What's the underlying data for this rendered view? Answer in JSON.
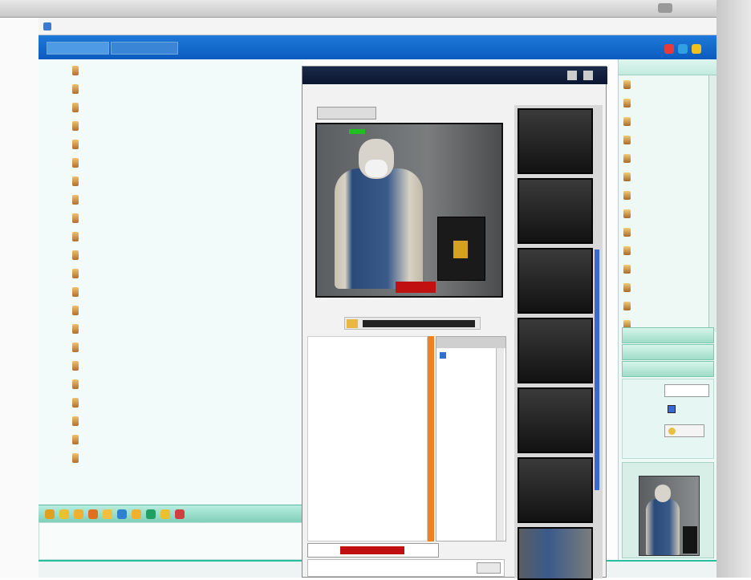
{
  "browser": {
    "title": "",
    "address": "",
    "tabs": [
      {
        "label": ""
      },
      {
        "label": ""
      }
    ]
  },
  "chat": {
    "lines": [
      {
        "ts": "",
        "name": "",
        "text": "",
        "name_color": "#2a9a2a",
        "text_color": "#2a9a2a"
      },
      {
        "ts": "",
        "name": "",
        "text": "",
        "name_color": "#d020c0",
        "text_color": "#d020c0"
      },
      {
        "ts": "",
        "name": "",
        "text": "",
        "name_color": "#8030d0",
        "text_color": "#20a080"
      },
      {
        "ts": "",
        "name": "",
        "text": "",
        "name_color": "#4040c0",
        "text_color": "#4040c0"
      },
      {
        "ts": "",
        "name": "",
        "text": "",
        "name_color": "#3a8a3a",
        "text_color": "#3a8a3a"
      },
      {
        "ts": "",
        "name": "",
        "text": "",
        "name_color": "#1a7ac0",
        "text_color": "#1a7ac0"
      },
      {
        "ts": "",
        "name": "",
        "text": "",
        "name_color": "#3050a0",
        "text_color": "#3050a0"
      },
      {
        "ts": "",
        "name": "",
        "text": "",
        "name_color": "#5a9a30",
        "text_color": "#5a9a30"
      },
      {
        "ts": "",
        "name": "",
        "text": "",
        "name_color": "#c0a020",
        "text_color": "#d040a0"
      },
      {
        "ts": "",
        "name": "",
        "text": "",
        "name_color": "#707070",
        "text_color": "#707070"
      },
      {
        "ts": "",
        "name": "",
        "text": "",
        "name_color": "#2060c0",
        "text_color": "#2060c0"
      },
      {
        "ts": "",
        "name": "",
        "text": "",
        "name_color": "#30a0a0",
        "text_color": "#d040d0"
      },
      {
        "ts": "",
        "name": "",
        "text": "",
        "name_color": "#308070",
        "text_color": "#308070"
      },
      {
        "ts": "",
        "name": "",
        "text": "",
        "name_color": "#406060",
        "text_color": "#406060"
      },
      {
        "ts": "",
        "name": "",
        "text": "",
        "name_color": "#4080c0",
        "text_color": "#4080c0"
      },
      {
        "ts": "",
        "name": "",
        "text": "",
        "name_color": "#3a7a3a",
        "text_color": "#3a7a3a"
      },
      {
        "ts": "",
        "name": "",
        "text": "",
        "name_color": "#d030d0",
        "text_color": "#909090"
      },
      {
        "ts": "",
        "name": "",
        "text": "",
        "name_color": "#506050",
        "text_color": "#506050"
      },
      {
        "ts": "",
        "name": "",
        "text": "",
        "name_color": "#30a060",
        "text_color": "#30a060"
      },
      {
        "ts": "",
        "name": "",
        "text": "",
        "name_color": "#2050b0",
        "text_color": "#2050b0"
      },
      {
        "ts": "",
        "name": "",
        "text": "",
        "name_color": "#c020c0",
        "text_color": "#8a8a8a"
      },
      {
        "ts": "",
        "name": "",
        "text": "",
        "name_color": "#30a0a0",
        "text_color": "#30a0a0"
      }
    ],
    "toolbar_icons": [
      "smiley-icon",
      "bell-icon",
      "smiley-icon",
      "star-icon",
      "smiley-icon",
      "image-icon",
      "smiley-icon",
      "music-icon",
      "smiley-icon",
      "heart-icon"
    ],
    "status_text": ""
  },
  "cam_window": {
    "title": "",
    "subtitle": "",
    "video_label": "",
    "video_caption": "",
    "viewer_name": "",
    "messages": [
      {
        "text": "",
        "color": "#d01010"
      },
      {
        "text": "",
        "color": "#d01010"
      },
      {
        "text": "",
        "color": "#d01010"
      },
      {
        "text": "",
        "color": "#d01010"
      },
      {
        "text": "",
        "color": "#20a020"
      },
      {
        "text": "",
        "color": "#d01010"
      },
      {
        "text": "",
        "color": "#d01010"
      },
      {
        "text": "",
        "color": "#d01010"
      },
      {
        "text": "",
        "color": "#d01010"
      },
      {
        "text": "",
        "color": "#d01010"
      },
      {
        "text": "",
        "color": "#d01010"
      },
      {
        "text": "",
        "color": "#d01010"
      },
      {
        "text": "",
        "color": "#909090"
      },
      {
        "text": "",
        "color": "#d01010"
      },
      {
        "text": "",
        "color": "#c020c0"
      },
      {
        "text": "",
        "color": "#d01010"
      },
      {
        "text": "",
        "color": "#d01010"
      },
      {
        "text": "",
        "color": "#d01010"
      },
      {
        "text": "",
        "color": "#d01010"
      }
    ],
    "viewer_list_header": "",
    "viewers": [
      {
        "name": ""
      }
    ],
    "input_value": "",
    "send_label": ""
  },
  "cam_tiles": [
    {
      "label": ""
    },
    {
      "label": ""
    },
    {
      "label": ""
    },
    {
      "label": ""
    },
    {
      "label": ""
    },
    {
      "label": ""
    }
  ],
  "user_list": {
    "users": [
      {
        "name": ""
      },
      {
        "name": ""
      },
      {
        "name": ""
      },
      {
        "name": ""
      },
      {
        "name": ""
      },
      {
        "name": ""
      },
      {
        "name": ""
      },
      {
        "name": ""
      },
      {
        "name": ""
      },
      {
        "name": ""
      },
      {
        "name": ""
      },
      {
        "name": ""
      },
      {
        "name": ""
      },
      {
        "name": ""
      }
    ],
    "sections": [
      {
        "label": ""
      },
      {
        "label": ""
      },
      {
        "label": ""
      }
    ],
    "field1_label": "",
    "field1_value": "",
    "field2_label": "",
    "button_label": ""
  },
  "taskbar": {
    "label": ""
  }
}
